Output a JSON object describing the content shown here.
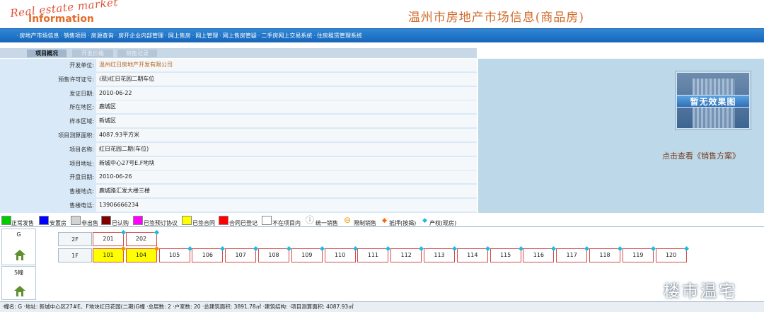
{
  "header": {
    "logo_line1": "Real estate market",
    "logo_line2": "Information",
    "site_title": "温州市房地产市场信息(商品房)"
  },
  "nav": {
    "items": [
      "房地产市场信息",
      "销售项目",
      "房源查询",
      "房开企业内部管理",
      "网上售房",
      "网上管理",
      "网上售房管疑",
      "二手房网上交易系统",
      "住房租赁管理系统"
    ],
    "separator": "·"
  },
  "tabs": [
    {
      "label": "项目概况",
      "active": true
    },
    {
      "label": "开发价格",
      "active": false
    },
    {
      "label": "销售记录",
      "active": false
    }
  ],
  "info": [
    {
      "label": "开发单位:",
      "value": "温州红日房地产开发有限公司",
      "link": true
    },
    {
      "label": "预售许可证号:",
      "value": "(现)红日花园二期车位",
      "link": false
    },
    {
      "label": "发证日期:",
      "value": "2010-06-22",
      "link": false
    },
    {
      "label": "所在地区:",
      "value": "鹿城区",
      "link": false
    },
    {
      "label": "样本区域:",
      "value": "新城区",
      "link": false
    },
    {
      "label": "项目测算面积:",
      "value": "4087.93平方米",
      "link": false
    },
    {
      "label": "项目名称:",
      "value": "红日花园二期(车位)",
      "link": false
    },
    {
      "label": "项目地址:",
      "value": "新城中心27号E.F地块",
      "link": false
    },
    {
      "label": "开盘日期:",
      "value": "2010-06-26",
      "link": false
    },
    {
      "label": "售楼地点:",
      "value": "鹿城路汇发大楼三楼",
      "link": false
    },
    {
      "label": "售楼电话:",
      "value": "13906666234",
      "link": false
    }
  ],
  "promo": {
    "image_text": "暂无效果图",
    "link_text": "点击查看《销售方案》"
  },
  "legend": {
    "normal": "正常发售",
    "resettle": "安置房",
    "not_for_sale": "非出售",
    "recognized": "已认购",
    "pre_signed": "已签预订协议",
    "contracted": "已签合同",
    "contract_registered": "合同已登记",
    "not_in_project": "不在项目内",
    "unified_sale": "统一销售",
    "restricted_sale": "限制销售",
    "mortgage": "抵押(按揭)",
    "property_right": "产权(现房)",
    "colors": {
      "normal": "#00cc00",
      "resettle": "#0000ff",
      "not_for_sale": "#d3d3d3",
      "recognized": "#800000",
      "pre_signed": "#ff00ff",
      "contracted": "#ffff00",
      "contract_registered": "#ff0000",
      "not_in_project": "#ffffff",
      "mortgage": "#ff6600",
      "property_right": "#22b8e0"
    }
  },
  "buildings": [
    {
      "name": "G",
      "icon": "house-icon"
    },
    {
      "name": "5幢",
      "icon": "house-icon"
    }
  ],
  "floors": [
    {
      "label": "2F",
      "units": [
        {
          "no": "201",
          "status": "normal"
        },
        {
          "no": "202",
          "status": "normal"
        }
      ]
    },
    {
      "label": "1F",
      "units": [
        {
          "no": "101",
          "status": "contracted"
        },
        {
          "no": "104",
          "status": "contracted"
        },
        {
          "no": "105",
          "status": "normal"
        },
        {
          "no": "106",
          "status": "normal"
        },
        {
          "no": "107",
          "status": "normal"
        },
        {
          "no": "108",
          "status": "normal"
        },
        {
          "no": "109",
          "status": "normal"
        },
        {
          "no": "110",
          "status": "normal"
        },
        {
          "no": "111",
          "status": "normal"
        },
        {
          "no": "112",
          "status": "normal"
        },
        {
          "no": "113",
          "status": "normal"
        },
        {
          "no": "114",
          "status": "normal"
        },
        {
          "no": "115",
          "status": "normal"
        },
        {
          "no": "116",
          "status": "normal"
        },
        {
          "no": "117",
          "status": "normal"
        },
        {
          "no": "118",
          "status": "normal"
        },
        {
          "no": "119",
          "status": "normal"
        },
        {
          "no": "120",
          "status": "normal"
        }
      ]
    }
  ],
  "footer": {
    "text": "·幢名: G ·地址: 新城中心区27#E、F地块红日花园(二期)G幢 ·总层数: 2 ·户室数: 20 ·总建筑面积: 3891.78㎡ ·建筑结构: ·项目测算面积: 4087.93㎡"
  },
  "watermark": "楼市温宅"
}
